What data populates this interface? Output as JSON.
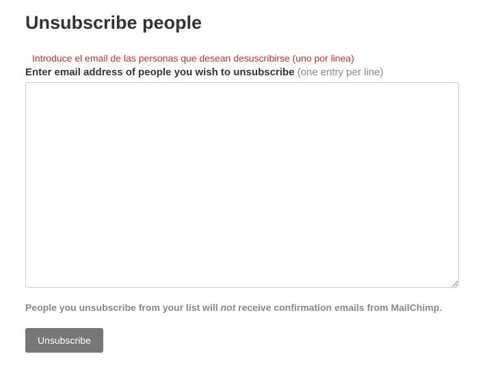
{
  "page": {
    "title": "Unsubscribe people"
  },
  "form": {
    "helper_text": "Introduce el email de las personas que desean desuscribirse (uno por linea)",
    "label_main": "Enter email address of people you wish to unsubscribe ",
    "label_hint": "(one entry per line)",
    "textarea_value": "",
    "note_before": "People you unsubscribe from your list will ",
    "note_italic": "not",
    "note_after": " receive confirmation emails from MailChimp.",
    "submit_label": "Unsubscribe"
  }
}
